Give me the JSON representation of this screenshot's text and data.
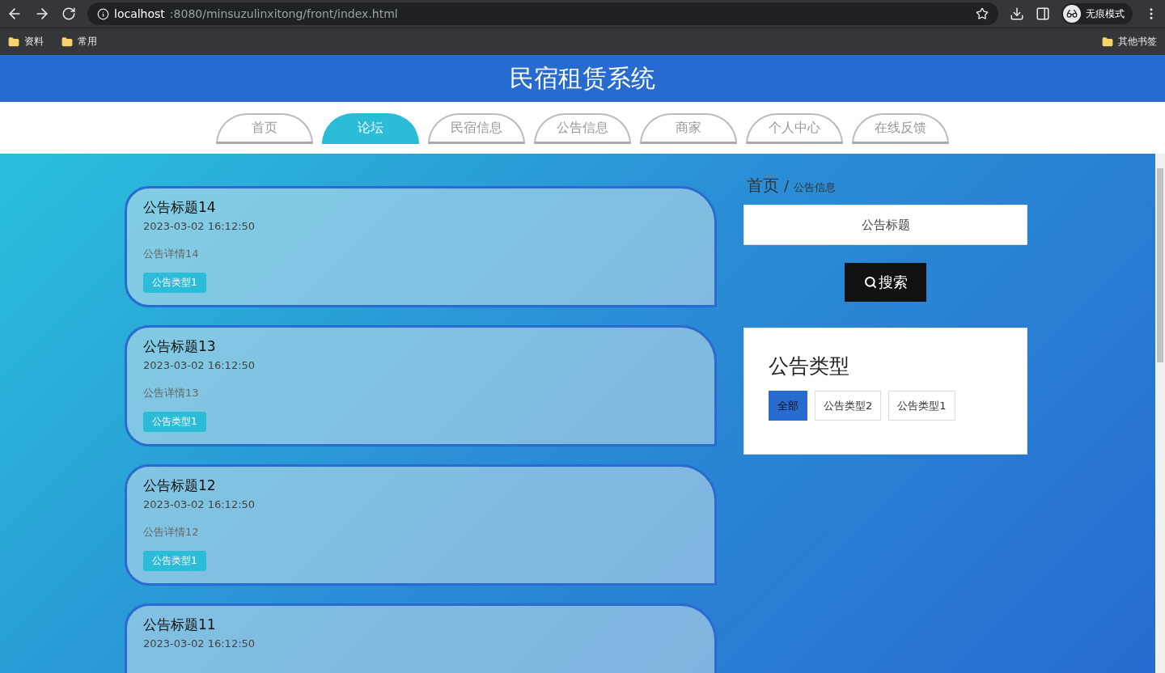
{
  "browser": {
    "url_host": "localhost",
    "url_path": ":8080/minsuzulinxitong/front/index.html",
    "profile": "无痕模式",
    "bookmarks": [
      "资料",
      "常用"
    ],
    "other_bookmarks": "其他书签"
  },
  "site_title": "民宿租赁系统",
  "nav": [
    {
      "label": "首页",
      "selected": false
    },
    {
      "label": "论坛",
      "selected": true
    },
    {
      "label": "民宿信息",
      "selected": false
    },
    {
      "label": "公告信息",
      "selected": false
    },
    {
      "label": "商家",
      "selected": false
    },
    {
      "label": "个人中心",
      "selected": false
    },
    {
      "label": "在线反馈",
      "selected": false
    }
  ],
  "notices": [
    {
      "title": "公告标题14",
      "date": "2023-03-02 16:12:50",
      "detail": "公告详情14",
      "tag": "公告类型1"
    },
    {
      "title": "公告标题13",
      "date": "2023-03-02 16:12:50",
      "detail": "公告详情13",
      "tag": "公告类型1"
    },
    {
      "title": "公告标题12",
      "date": "2023-03-02 16:12:50",
      "detail": "公告详情12",
      "tag": "公告类型1"
    },
    {
      "title": "公告标题11",
      "date": "2023-03-02 16:12:50"
    }
  ],
  "breadcrumb": {
    "home": "首页",
    "separator": "/",
    "current": "公告信息"
  },
  "search": {
    "placeholder": "公告标题",
    "button": "搜索"
  },
  "categories": {
    "title": "公告类型",
    "items": [
      {
        "label": "全部",
        "selected": true
      },
      {
        "label": "公告类型2",
        "selected": false
      },
      {
        "label": "公告类型1",
        "selected": false
      }
    ]
  }
}
